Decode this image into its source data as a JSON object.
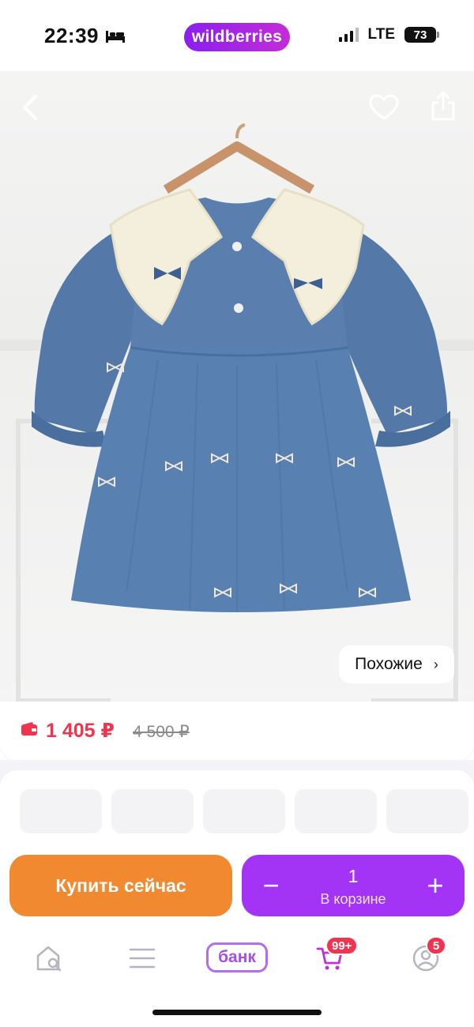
{
  "status_bar": {
    "time": "22:39",
    "network": "LTE",
    "battery": "73",
    "brand": "wildberries"
  },
  "product": {
    "similar_label": "Похожие",
    "price_current": "1 405 ₽",
    "price_old": "4 500 ₽"
  },
  "actions": {
    "buy_now": "Купить сейчас",
    "quantity": "1",
    "in_cart": "В корзине",
    "minus": "−",
    "plus": "+"
  },
  "nav": {
    "bank_label": "банк",
    "cart_badge": "99+",
    "profile_badge": "5"
  },
  "colors": {
    "accent_purple": "#a333f5",
    "buy_orange": "#f0892f",
    "price_red": "#f0344f"
  }
}
